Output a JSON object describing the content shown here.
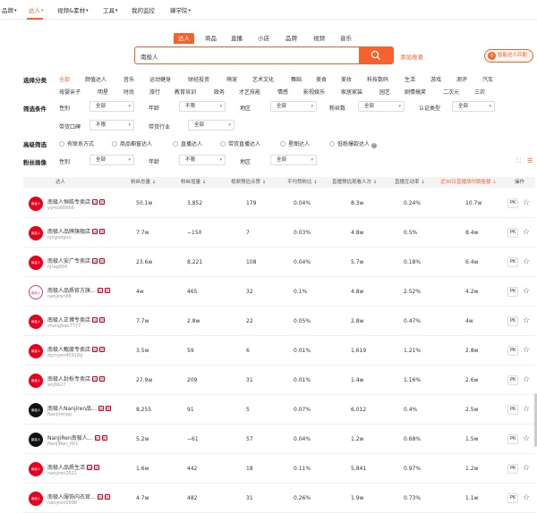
{
  "topnav": [
    {
      "label": "品牌",
      "active": false
    },
    {
      "label": "达人",
      "active": true
    },
    {
      "label": "视频&素材",
      "active": false
    },
    {
      "label": "工具",
      "active": false
    },
    {
      "label": "我的监控",
      "active": false
    },
    {
      "label": "蝉学院",
      "active": false
    }
  ],
  "tabs": [
    "达人",
    "商品",
    "直播",
    "小店",
    "品牌",
    "视频",
    "音乐"
  ],
  "search": {
    "value": "南极人"
  },
  "collect_label": "添加收录",
  "smart_label": "智能达人匹配",
  "category": {
    "label": "选择分类",
    "row1": [
      "全部",
      "颜值达人",
      "音乐",
      "运动健身",
      "财经投资",
      "萌宠",
      "艺术文化",
      "舞蹈",
      "美食",
      "美妆",
      "科技数码",
      "生活",
      "游戏",
      "测评",
      "汽车"
    ],
    "row2": [
      "母婴亲子",
      "明星",
      "时尚",
      "旅行",
      "教育培训",
      "政务",
      "才艺技能",
      "情感",
      "影视娱乐",
      "家居家装",
      "园艺",
      "剧情搞笑",
      "二次元",
      "三农"
    ]
  },
  "filter": {
    "label": "筛选条件",
    "gender_label": "性别",
    "gender_value": "全部",
    "age_label": "年龄",
    "age_value": "不限",
    "region_label": "地区",
    "region_value": "全部",
    "fans_label": "粉丝数",
    "fans_value": "全部",
    "cert_label": "认证类型",
    "cert_value": "全部",
    "goods_label": "带货口碑",
    "goods_value": "不限",
    "industry_label": "带货行业",
    "industry_value": "全部"
  },
  "advanced": {
    "label": "高级筛选",
    "options": [
      "有联系方式",
      "商品橱窗达人",
      "直播达人",
      "带货直播达人",
      "星图达人",
      "低粉爆款达人"
    ]
  },
  "fans": {
    "label": "粉丝画像",
    "gender_label": "性别",
    "gender_value": "全部",
    "age_label": "年龄",
    "age_value": "不限",
    "region_label": "地区",
    "region_value": "全部"
  },
  "table": {
    "headers": [
      "达人",
      "粉丝总量",
      "粉丝增量",
      "视频预估点赞",
      "平均赞粉比",
      "直播预估观看人次",
      "直播互动率",
      "近30日直播场均销售额",
      "操作"
    ],
    "rows": [
      {
        "name": "南极人恒皓专卖店",
        "id": "yymo66666",
        "fans": "50.1w",
        "inc": "3,852",
        "likes": "179",
        "ratio": "0.04%",
        "views": "8.3w",
        "inter": "0.24%",
        "sales": "10.7w"
      },
      {
        "name": "南极人品牌旗舰店",
        "id": "njnguoguo",
        "fans": "7.7w",
        "inc": "−150",
        "likes": "7",
        "ratio": "0.03%",
        "views": "4.8w",
        "inter": "0.5%",
        "sales": "8.4w"
      },
      {
        "name": "南极人安广专卖店",
        "id": "njrag666",
        "fans": "23.6w",
        "inc": "8,221",
        "likes": "108",
        "ratio": "0.04%",
        "views": "5.7w",
        "inter": "0.18%",
        "sales": "6.4w"
      },
      {
        "name": "南极人品质官方旗...",
        "id": "nanjiren88",
        "fans": "4w",
        "inc": "465",
        "likes": "32",
        "ratio": "0.1%",
        "views": "4.8w",
        "inter": "2.52%",
        "sales": "4.2w"
      },
      {
        "name": "南极人正博专卖店",
        "id": "zhongbao7777",
        "fans": "7.7w",
        "inc": "2.8w",
        "likes": "22",
        "ratio": "0.05%",
        "views": "2.8w",
        "inter": "0.47%",
        "sales": "4w"
      },
      {
        "name": "南极人甄度专卖店",
        "id": "dymyen45918g",
        "fans": "3.5w",
        "inc": "59",
        "likes": "6",
        "ratio": "0.01%",
        "views": "1,619",
        "inter": "1.21%",
        "sales": "2.8w"
      },
      {
        "name": "南极人封栎专卖店",
        "id": "anjh627",
        "fans": "27.9w",
        "inc": "209",
        "likes": "31",
        "ratio": "0.01%",
        "views": "1.4w",
        "inter": "1.16%",
        "sales": "2.6w"
      },
      {
        "name": "南极人Nanjiren品...",
        "id": "Nanjirenpp",
        "fans": "8,255",
        "inc": "91",
        "likes": "5",
        "ratio": "0.07%",
        "views": "6,012",
        "inter": "0.4%",
        "sales": "2.5w"
      },
      {
        "name": "NanJiRen南极人...",
        "id": "NanJiRen_001",
        "fans": "5.2w",
        "inc": "−61",
        "likes": "57",
        "ratio": "0.04%",
        "views": "1.2w",
        "inter": "0.68%",
        "sales": "1.5w"
      },
      {
        "name": "南极人品质生活",
        "id": "nanjiren2021",
        "fans": "1.6w",
        "inc": "442",
        "likes": "18",
        "ratio": "0.11%",
        "views": "5,841",
        "inter": "0.97%",
        "sales": "1.2w"
      },
      {
        "name": "南极人服饰内衣官...",
        "id": "nanjiren0998",
        "fans": "4.7w",
        "inc": "482",
        "likes": "31",
        "ratio": "0.26%",
        "views": "1.9w",
        "inter": "0.73%",
        "sales": "1.1w"
      }
    ],
    "pk_label": "PK",
    "logo_text": "南极人"
  }
}
